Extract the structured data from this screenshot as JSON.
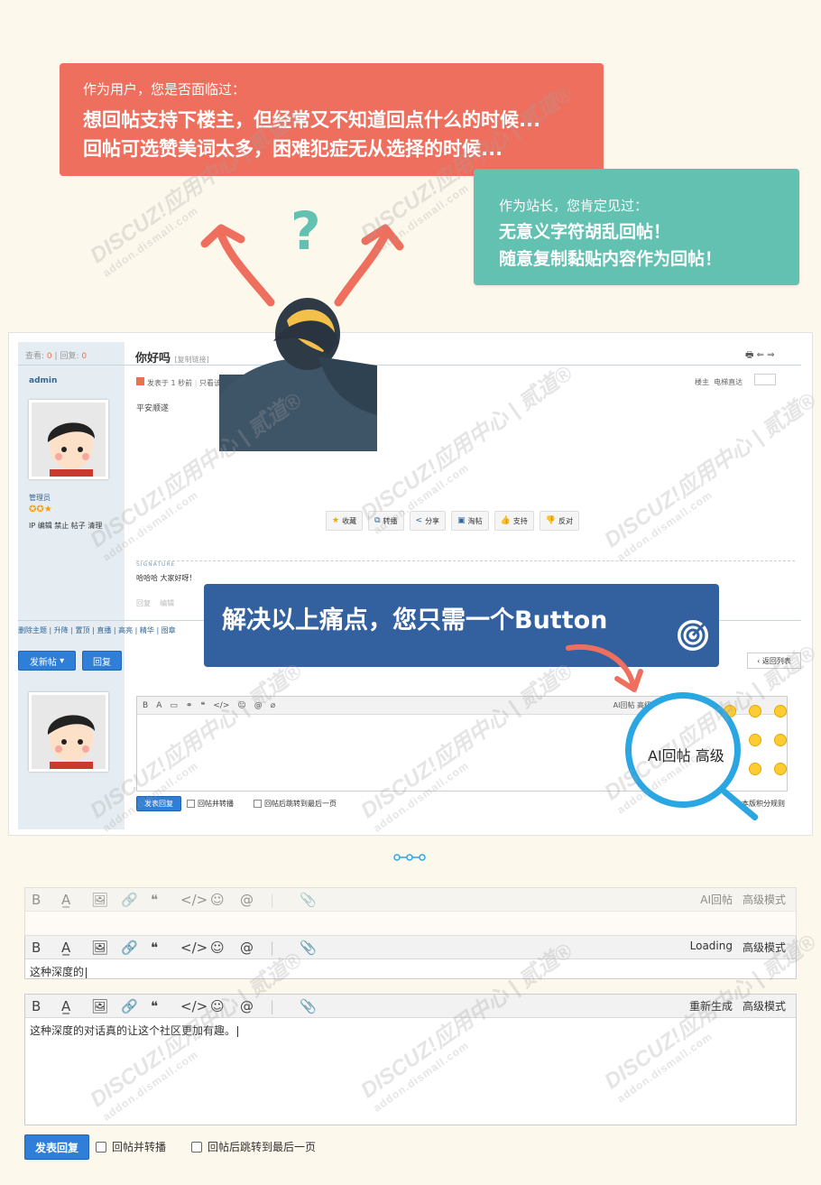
{
  "top_box_red": {
    "small": "作为用户，您是否面临过：",
    "line1": "想回帖支持下楼主，但经常又不知道回点什么的时候...",
    "line2": "回帖可选赞美词太多，困难犯症无从选择的时候..."
  },
  "top_box_teal": {
    "small": "作为站长，您肯定见过：",
    "line1": "无意义字符胡乱回帖！",
    "line2": "随意复制黏贴内容作为回帖！"
  },
  "question_mark": "?",
  "forum": {
    "stat_view_label": "查看:",
    "stat_view_value": "0",
    "stat_sep": "|",
    "stat_reply_label": "回复:",
    "stat_reply_value": "0",
    "thread_title": "你好吗",
    "copy_link": "[复制链接]",
    "author": "admin",
    "post_meta": "发表于 1 秒前",
    "post_meta_extra": "只看该",
    "louzhu": "楼主",
    "lou_jump": "电梯直达",
    "post_body": "平安顺遂",
    "role": "管理员",
    "user_actions": "IP 编辑 禁止 帖子 清理",
    "actions": [
      "收藏",
      "转播",
      "分享",
      "淘帖",
      "支持",
      "反对"
    ],
    "signature_label": "SIGNATURE",
    "signature": "哈哈哈 大家好呀！",
    "grey_actions": "回复",
    "grey_actions2": "编辑",
    "mod_bar": "删除主题 | 升降 | 置顶 | 直播 | 高亮 | 精华 | 图章",
    "new_thread_btn": "发新帖",
    "reply_btn": "回复",
    "back_list": "返回列表",
    "mini_toolbar_right": "AI回帖 高级",
    "submit_btn": "发表回复",
    "opt_forward": "回帖并转播",
    "opt_jump": "回帖后跳转到最后一页",
    "rules": "本版积分规则"
  },
  "banner_text": "解决以上痛点，您只需一个Button",
  "magnifier_text": "AI回帖 高级",
  "editors": [
    {
      "right": [
        "AI回帖",
        "高级模式"
      ],
      "content": ""
    },
    {
      "right": [
        "Loading",
        "高级模式"
      ],
      "content": "这种深度的"
    },
    {
      "right": [
        "重新生成",
        "高级模式"
      ],
      "content": "这种深度的对话真的让这个社区更加有趣。"
    }
  ],
  "toolbar_icons": [
    "B",
    "A̲",
    "🖼",
    "🔗",
    "❝",
    "</>",
    "☺",
    "@",
    "|",
    "📎"
  ],
  "submit2": "发表回复",
  "opt2_forward": "回帖并转播",
  "opt2_jump": "回帖后跳转到最后一页",
  "watermark_brand": "DISCUZ!应用中心 | 贰道®",
  "watermark_url": "addon.dismall.com",
  "colors": {
    "red_box": "#ef6f5e",
    "teal_box": "#63c1b2",
    "banner_blue": "#33609e",
    "magnifier_blue": "#2aa7e2",
    "button_blue": "#2f7ed8"
  }
}
